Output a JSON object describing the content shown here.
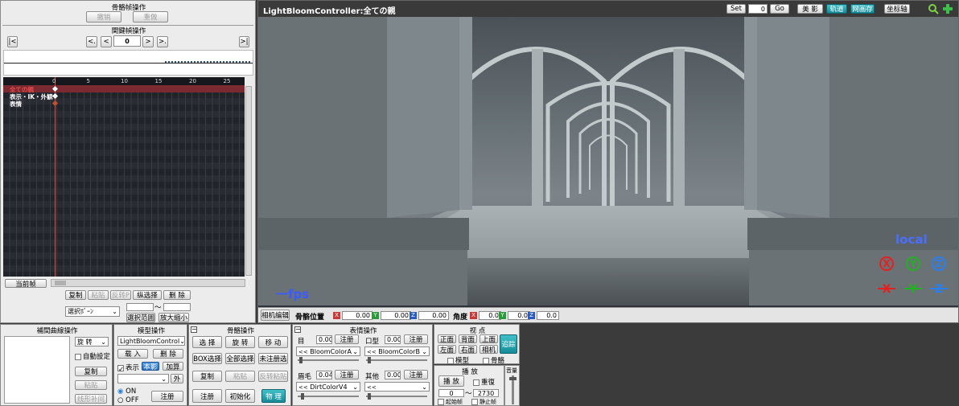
{
  "bone_ops": {
    "title": "骨骼帧操作",
    "undo": "撤销",
    "redo": "重做"
  },
  "keyframe": {
    "title": "関鍵幀操作",
    "first": "|<",
    "prev_key": "<.",
    "prev": "<",
    "frame": "0",
    "next": ">",
    "next_key": ">.",
    "last": ">|",
    "ticks": [
      "0",
      "5",
      "10",
      "15",
      "20",
      "25"
    ],
    "tracks": [
      {
        "label": "全ての親",
        "color": "#e34a4a"
      },
      {
        "label": "表示・IK・外観",
        "color": "#ffffff"
      },
      {
        "label": "表情",
        "color": "#ffffff"
      }
    ],
    "current_frame_btn": "当前帧"
  },
  "edit_buttons": {
    "copy": "复制",
    "paste": "粘贴",
    "paste_reverse": "反转P",
    "v_select": "纵选择",
    "delete": "删 除",
    "select_mode": "選択ﾎﾞｰﾝ",
    "range_select": "選択范囲",
    "zoom": "放大缩小",
    "tilde": "〜"
  },
  "viewport": {
    "title": "LightBloomController:全ての親",
    "set": "Set",
    "set_value": "0",
    "go": "Go",
    "toggles": [
      "美 影",
      "轨道",
      "网画存",
      "坐标轴"
    ],
    "fps": "一fps",
    "local": "local",
    "rot_axes": [
      "X",
      "Y",
      "Z"
    ],
    "move_axes": [
      "X",
      "Y",
      "Z"
    ],
    "axis_colors": {
      "x": "#e52020",
      "y": "#20b020",
      "z": "#2a7ff0"
    }
  },
  "status_bar": {
    "camera_edit": "相机编辑",
    "bone_pos": "骨骼位置",
    "pos": {
      "x": "0.00",
      "y": "0.00",
      "z": "0.00"
    },
    "angle": "角度",
    "rot": {
      "x": "0.0",
      "y": "0.0",
      "z": "0.0"
    }
  },
  "interp": {
    "title": "補間曲線操作",
    "rotate": "旋 转",
    "auto": "自動設定",
    "copy": "复制",
    "paste": "粘贴",
    "linear": "线形补间"
  },
  "model": {
    "title": "模型操作",
    "model_name": "LightBloomControl",
    "load": "载 入",
    "delete": "删 除",
    "show": "表示",
    "render": "本影",
    "add": "加算",
    "outside": "外",
    "on": "ON",
    "off": "OFF",
    "register": "注册"
  },
  "bone": {
    "title": "骨骼操作",
    "select": "选 择",
    "rotate": "旋 转",
    "move": "移 动",
    "box_select": "BOX选择",
    "all_select": "全部选择",
    "unreg_select": "未注册选",
    "copy": "复制",
    "paste": "粘贴",
    "reverse_paste": "反转粘贴",
    "register": "注册",
    "init": "初始化",
    "physics": "物 理"
  },
  "morph": {
    "title": "表情操作",
    "eye": {
      "label": "目",
      "value": "0.00",
      "name": "BloomColorA"
    },
    "mouth": {
      "label": "口型",
      "value": "0.00",
      "name": "BloomColorB"
    },
    "brow": {
      "label": "眉毛",
      "value": "0.04",
      "name": "DirtColorV4"
    },
    "other": {
      "label": "其他",
      "value": "0.00",
      "name": ""
    },
    "register": "注册"
  },
  "view": {
    "title": "视 点",
    "front": "正面",
    "back": "背面",
    "top": "上面",
    "left": "左面",
    "right": "右面",
    "camera": "相机",
    "model_chk": "模型",
    "bone_chk": "骨骼",
    "trace": "追踪"
  },
  "play": {
    "title": "播 放",
    "play": "播 放",
    "repeat": "重復",
    "from": "0",
    "to": "2730",
    "start_chk": "起始帧",
    "stop_chk": "静止帧",
    "volume": "音量"
  }
}
